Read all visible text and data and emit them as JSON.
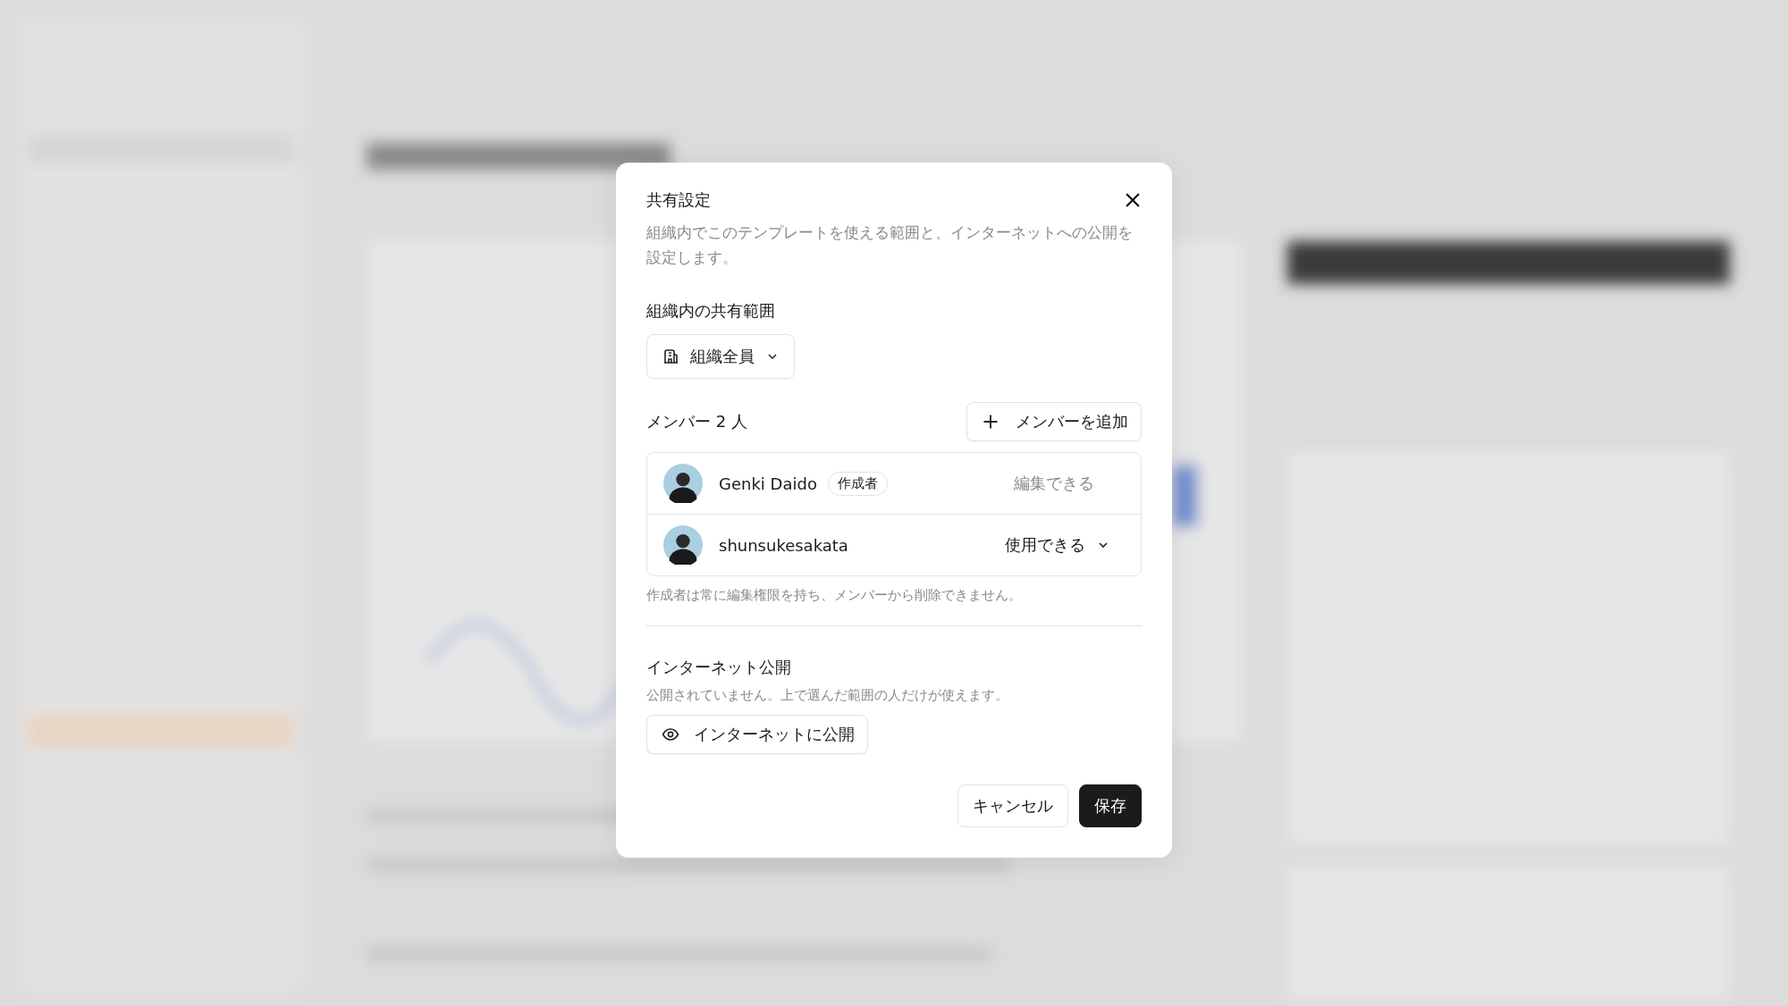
{
  "dialog": {
    "title": "共有設定",
    "description": "組織内でこのテンプレートを使える範囲と、インターネットへの公開を設定します。",
    "scope": {
      "label": "組織内の共有範囲",
      "value": "組織全員"
    },
    "members": {
      "heading": "メンバー 2 人",
      "add_button": "メンバーを追加",
      "items": [
        {
          "name": "Genki Daido",
          "badge": "作成者",
          "permission": "編集できる",
          "dropdown": false
        },
        {
          "name": "shunsukesakata",
          "permission": "使用できる",
          "dropdown": true
        }
      ],
      "note": "作成者は常に編集権限を持ち、メンバーから削除できません。"
    },
    "internet": {
      "label": "インターネット公開",
      "status": "公開されていません。上で選んだ範囲の人だけが使えます。",
      "button": "インターネットに公開"
    },
    "buttons": [
      "キャンセル",
      "保存"
    ]
  }
}
